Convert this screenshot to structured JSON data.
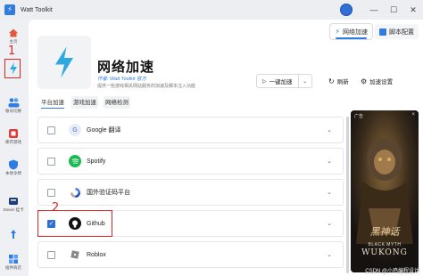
{
  "window": {
    "title": "Watt Toolkit",
    "controls": [
      "—",
      "☐",
      "✕"
    ]
  },
  "top_tabs": [
    {
      "label": "网络加速",
      "active": true
    },
    {
      "label": "脚本配置",
      "active": false
    }
  ],
  "sidebar": {
    "items": [
      {
        "label": "主页",
        "icon": "home-icon"
      },
      {
        "label": "",
        "icon": "lightning-icon"
      },
      {
        "label": "账号切换",
        "icon": "users-icon"
      },
      {
        "label": "库存游戏",
        "icon": "game-library-icon"
      },
      {
        "label": "本地令牌",
        "icon": "auth-token-icon"
      },
      {
        "label": "Steam 挂卡",
        "icon": "steam-idle-icon"
      },
      {
        "label": "",
        "icon": "pin-icon"
      },
      {
        "label": "插件商店",
        "icon": "plugin-store-icon"
      }
    ]
  },
  "annotations": {
    "num1": "1",
    "num2": "2"
  },
  "plugin": {
    "title": "网络加速",
    "author": "作者: Watt Toolkit 官方",
    "description": "提供一些游戏相关网站服务的加速及脚本注入功能"
  },
  "toolbar": {
    "accelerate": "一键加速",
    "refresh": "刷新",
    "settings": "加速设置"
  },
  "sub_tabs": [
    {
      "label": "平台加速",
      "active": true
    },
    {
      "label": "游戏加速",
      "active": false
    },
    {
      "label": "网络检测",
      "active": false
    }
  ],
  "list": [
    {
      "name": "Google 翻译",
      "checked": false,
      "icon": "google-translate-icon",
      "color": "#6f8fd8"
    },
    {
      "name": "Spotify",
      "checked": false,
      "icon": "spotify-icon",
      "color": "#1db954"
    },
    {
      "name": "国外验证码平台",
      "checked": false,
      "icon": "recaptcha-icon",
      "color": "#4a7be0"
    },
    {
      "name": "Github",
      "checked": true,
      "icon": "github-icon",
      "color": "#111111"
    },
    {
      "name": "Roblox",
      "checked": false,
      "icon": "roblox-icon",
      "color": "#888888"
    }
  ],
  "ad": {
    "label": "广告",
    "close": "×",
    "game_title": "BLACK MYTH",
    "game_subtitle": "WUKONG",
    "watermark": "CSDN @小鸡编程设计"
  },
  "colors": {
    "accent": "#2f7de1",
    "annotation": "#e02424"
  }
}
